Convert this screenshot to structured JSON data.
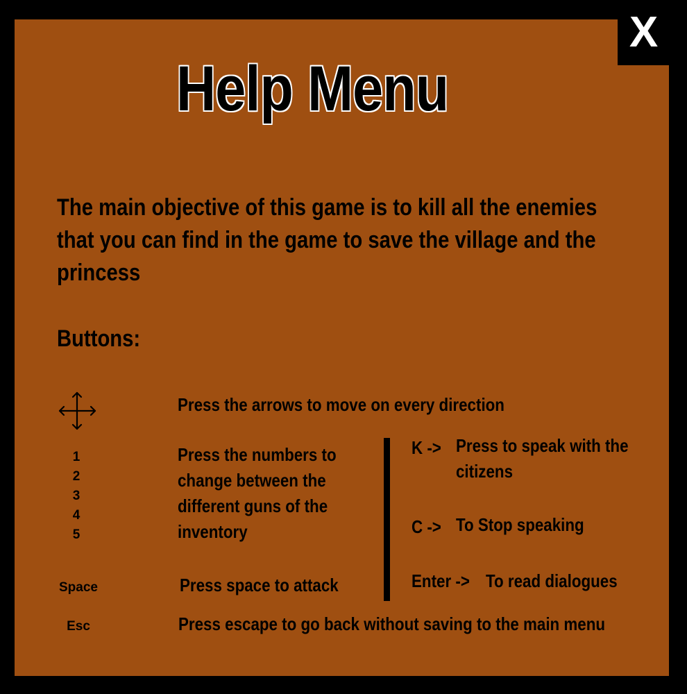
{
  "title": "Help Menu",
  "close_label": "X",
  "objective": "The main objective of this game is to kill all the enemies that you can find in the game to save the village and the princess",
  "buttons_heading": "Buttons:",
  "controls": {
    "arrows": {
      "icon": "move-arrows-icon",
      "description": "Press the arrows to move on every direction"
    },
    "numbers": {
      "keys": [
        "1",
        "2",
        "3",
        "4",
        "5"
      ],
      "description": "Press the numbers to change between the different  guns of the inventory"
    },
    "space": {
      "key": "Space",
      "description": "Press space to attack"
    },
    "esc": {
      "key": "Esc",
      "description": "Press escape to go back without saving to the main menu"
    },
    "k": {
      "key": "K ->",
      "description": "Press to speak with the citizens"
    },
    "c": {
      "key": "C ->",
      "description": "To Stop speaking"
    },
    "enter": {
      "key": "Enter ->",
      "description": "To read dialogues"
    }
  },
  "colors": {
    "panel": "#9f4f11",
    "background": "#000000",
    "text": "#000000",
    "title_outline": "#ffffff"
  }
}
